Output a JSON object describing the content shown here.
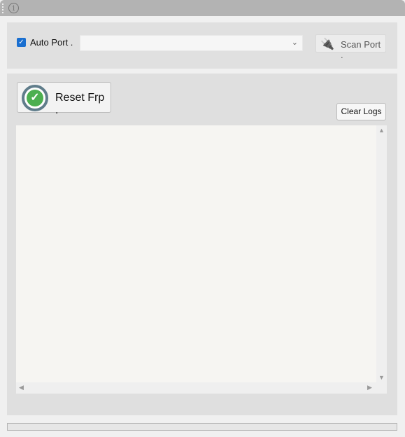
{
  "titlebar": {
    "info_icon": "info-icon"
  },
  "port": {
    "auto_port_label": "Auto Port .",
    "auto_port_checked": true,
    "port_value": "",
    "scan_label": "Scan Port ."
  },
  "actions": {
    "reset_label": "Reset Frp .",
    "clear_label": "Clear Logs"
  },
  "log": {
    "text": ""
  },
  "progress": {
    "value": 0
  },
  "colors": {
    "accent": "#1a6fd0",
    "check_green": "#4caf50",
    "ring": "#607d8b"
  }
}
